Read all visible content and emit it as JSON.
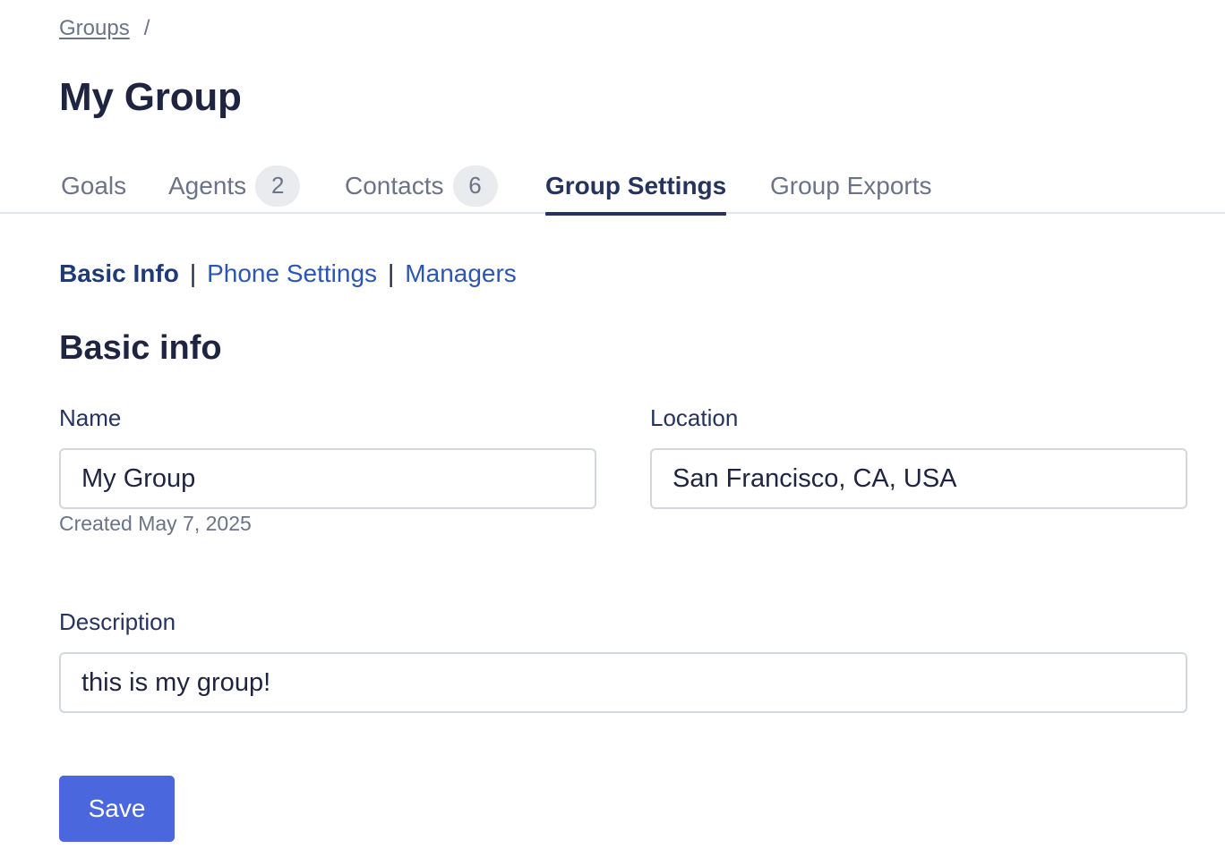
{
  "breadcrumb": {
    "parent_label": "Groups",
    "separator": "/"
  },
  "page_title": "My Group",
  "tabs": [
    {
      "label": "Goals",
      "badge": null,
      "active": false
    },
    {
      "label": "Agents",
      "badge": "2",
      "active": false
    },
    {
      "label": "Contacts",
      "badge": "6",
      "active": false
    },
    {
      "label": "Group Settings",
      "badge": null,
      "active": true
    },
    {
      "label": "Group Exports",
      "badge": null,
      "active": false
    }
  ],
  "subnav": {
    "current": "Basic Info",
    "links": [
      "Phone Settings",
      "Managers"
    ],
    "separator": "|"
  },
  "section_title": "Basic info",
  "form": {
    "name": {
      "label": "Name",
      "value": "My Group",
      "hint": "Created May 7, 2025"
    },
    "location": {
      "label": "Location",
      "value": "San Francisco, CA, USA"
    },
    "description": {
      "label": "Description",
      "value": "this is my group!"
    },
    "save_label": "Save"
  },
  "colors": {
    "accent": "#4a67de",
    "active_tab": "#26335f",
    "link": "#2c55b8",
    "muted": "#6b7386"
  }
}
